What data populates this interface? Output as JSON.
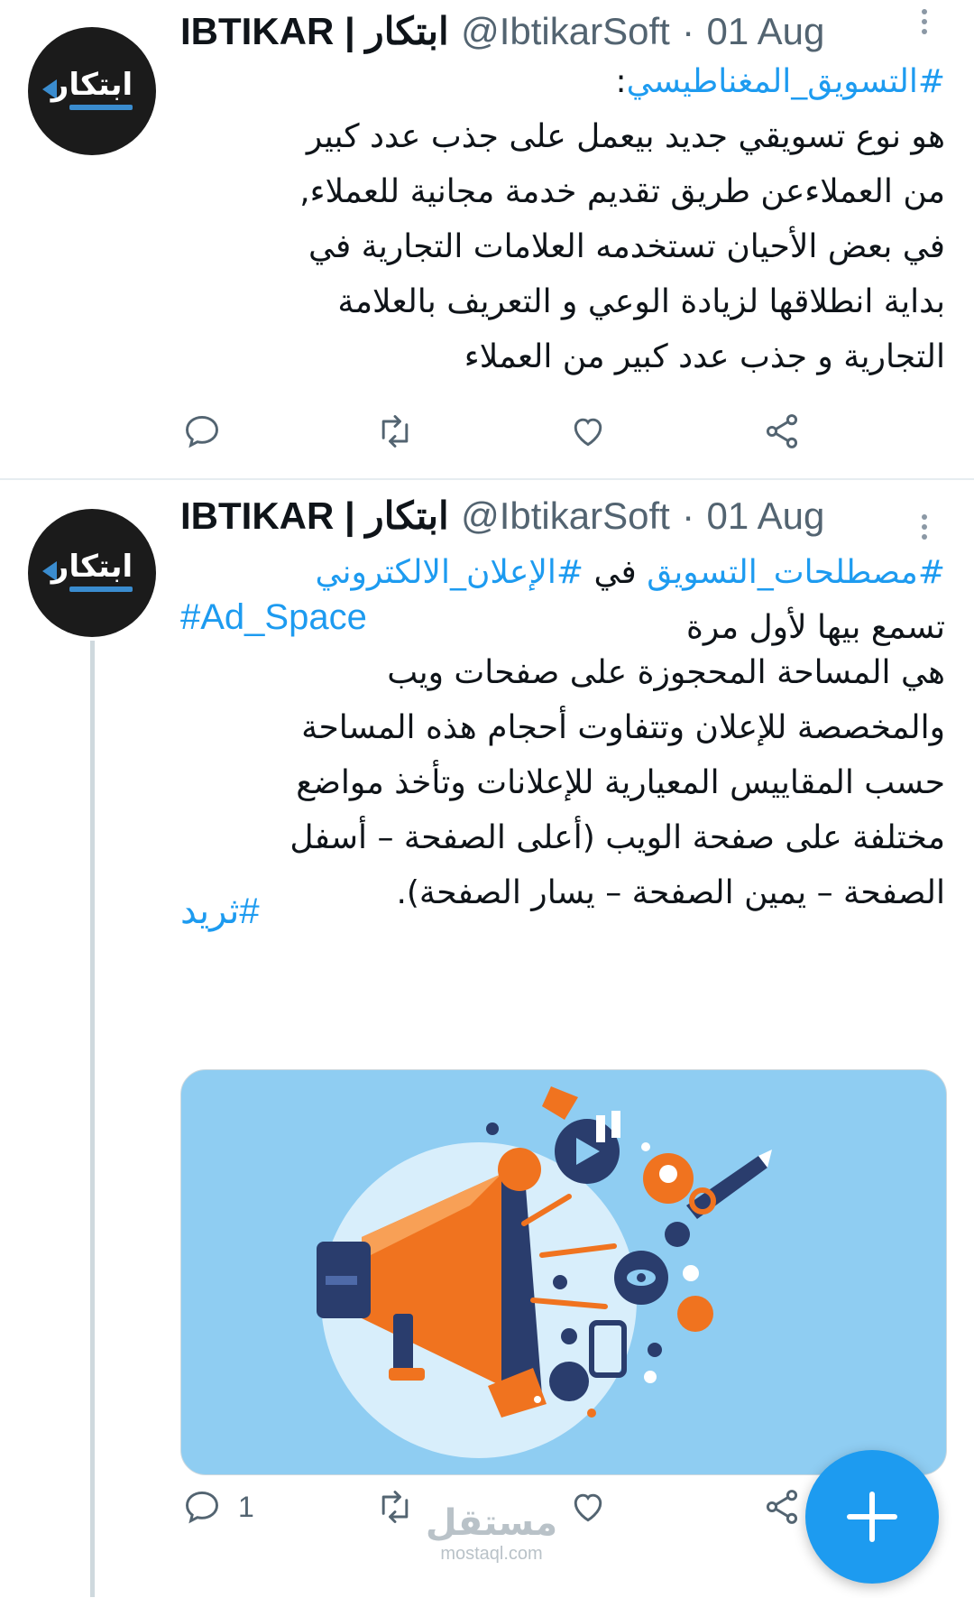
{
  "colors": {
    "accent": "#1d9bf0",
    "text": "#0f1419",
    "muted": "#536471",
    "media_bg": "#8fcdf2",
    "orange": "#f0731f",
    "navy": "#2a3d6d"
  },
  "tweets": [
    {
      "avatar": {
        "logo_text": "ابتكار",
        "icon": "ibtikar-logo"
      },
      "author_name": "IBTIKAR | ابتكار",
      "handle": "@IbtikarSoft",
      "separator": "·",
      "date": "01 Aug",
      "more_icon": "more-vertical-icon",
      "hashtag_line": "#التسويق_المغناطيسي",
      "hashtag_suffix": ":",
      "body_lines": [
        "هو نوع تسويقي جديد بيعمل على جذب عدد كبير",
        "من العملاءعن طريق تقديم خدمة مجانية للعملاء,",
        "في بعض الأحيان تستخدمه العلامات التجارية في",
        "بداية انطلاقها لزيادة الوعي و التعريف بالعلامة",
        "التجارية و جذب عدد كبير من العملاء"
      ],
      "actions": {
        "reply_icon": "reply-icon",
        "retweet_icon": "retweet-icon",
        "like_icon": "heart-icon",
        "share_icon": "share-icon"
      }
    },
    {
      "avatar": {
        "logo_text": "ابتكار",
        "icon": "ibtikar-logo"
      },
      "author_name": "IBTIKAR | ابتكار",
      "handle": "@IbtikarSoft",
      "separator": "·",
      "date": "01 Aug",
      "more_icon": "more-vertical-icon",
      "hashtag_1": "#مصطلحات_التسويق",
      "word_in": "في",
      "hashtag_2": "#الإعلان_الالكتروني",
      "line_2": "تسمع بيها لأول مرة",
      "tag_en": "#Ad_Space",
      "body_lines": [
        "هي المساحة المحجوزة على صفحات ويب",
        "والمخصصة للإعلان وتتفاوت أحجام هذه المساحة",
        "حسب المقاييس المعيارية للإعلانات وتأخذ مواضع",
        "مختلفة على صفحة الويب (أعلى الصفحة – أسفل",
        "الصفحة – يمين الصفحة – يسار الصفحة)."
      ],
      "tag_thread": "#ثريد",
      "media": {
        "description_icon": "megaphone-marketing-illustration"
      },
      "actions": {
        "reply_icon": "reply-icon",
        "reply_count": "1",
        "retweet_icon": "retweet-icon",
        "like_icon": "heart-icon",
        "share_icon": "share-icon"
      }
    }
  ],
  "fab": {
    "icon": "plus-icon"
  },
  "watermark": {
    "arabic": "مستقل",
    "latin": "mostaql.com"
  }
}
